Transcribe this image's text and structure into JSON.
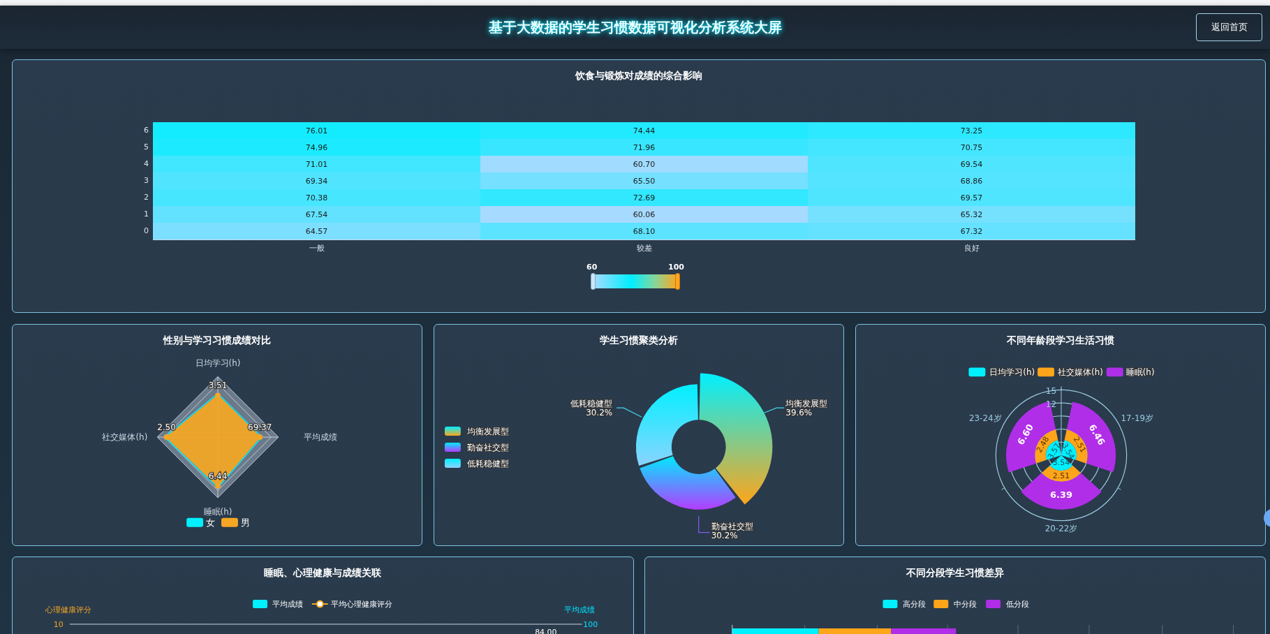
{
  "header": {
    "title": "基于大数据的学生习惯数据可视化分析系统大屏",
    "button": "返回首页"
  },
  "heatmap_panel": {
    "title": "饮食与锻炼对成绩的综合影响",
    "x_categories": [
      "一般",
      "较差",
      "良好"
    ],
    "y_categories": [
      "6",
      "5",
      "4",
      "3",
      "2",
      "1",
      "0"
    ],
    "rows": [
      [
        "76.01",
        "74.44",
        "73.25"
      ],
      [
        "74.96",
        "71.96",
        "70.75"
      ],
      [
        "71.01",
        "60.70",
        "69.54"
      ],
      [
        "69.34",
        "65.50",
        "68.86"
      ],
      [
        "70.38",
        "72.69",
        "69.57"
      ],
      [
        "67.54",
        "60.06",
        "65.32"
      ],
      [
        "64.57",
        "68.10",
        "67.32"
      ]
    ],
    "scale": {
      "min_label": "60",
      "max_label": "100"
    }
  },
  "gender_panel": {
    "title": "性别与学习习惯成绩对比",
    "axes": [
      "日均学习(h)",
      "平均成绩",
      "睡眠(h)",
      "社交媒体(h)"
    ],
    "value_labels": [
      "3.51",
      "69.37",
      "6.44",
      "2.50"
    ],
    "legend": [
      {
        "name": "女",
        "color": "#00f0ff"
      },
      {
        "name": "男",
        "color": "#f5a623"
      }
    ]
  },
  "cluster_panel": {
    "title": "学生习惯聚类分析",
    "chart_data": {
      "type": "donut",
      "categories": [
        "均衡发展型",
        "勤奋社交型",
        "低耗稳健型"
      ],
      "values": [
        39.6,
        30.2,
        30.2
      ],
      "value_labels": [
        "39.6%",
        "30.2%",
        "30.2%"
      ],
      "legend": true
    }
  },
  "age_panel": {
    "title": "不同年龄段学习生活习惯",
    "categories": [
      "17-19岁",
      "20-22岁",
      "23-24岁"
    ],
    "radius_ticks": [
      "15",
      "12"
    ],
    "series": [
      {
        "name": "日均学习(h)",
        "color": "#00f0ff",
        "value_labels": [
          "3.54",
          "3.54",
          "3.57"
        ]
      },
      {
        "name": "社交媒体(h)",
        "color": "#ffa51a",
        "value_labels": [
          "2.51",
          "2.51",
          "2.48"
        ]
      },
      {
        "name": "睡眠(h)",
        "color": "#b02ee8",
        "value_labels": [
          "6.46",
          "6.39",
          "6.60"
        ]
      }
    ]
  },
  "mental_panel": {
    "title": "睡眠、心理健康与成绩关联",
    "legend": [
      {
        "name": "平均成绩",
        "kind": "bar",
        "color": "#00f0ff"
      },
      {
        "name": "平均心理健康评分",
        "kind": "line",
        "color": "#f5a623"
      }
    ],
    "left_axis_name": "心理健康评分",
    "right_axis_name": "平均成绩",
    "left_tick": "10",
    "right_tick": "100",
    "value_label": "84.00"
  },
  "segment_panel": {
    "title": "不同分段学生习惯差异",
    "legend": [
      {
        "name": "高分段",
        "color": "#00f0ff"
      },
      {
        "name": "中分段",
        "color": "#ffa51a"
      },
      {
        "name": "低分段",
        "color": "#b02ee8"
      }
    ]
  }
}
